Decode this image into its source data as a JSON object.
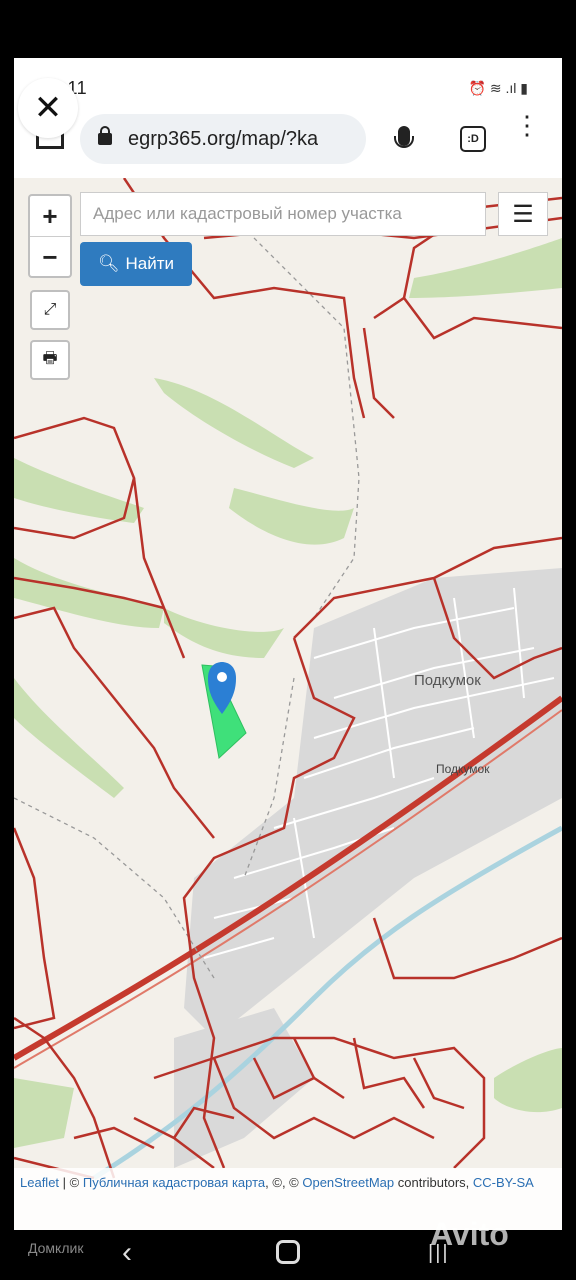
{
  "status": {
    "time": ":11",
    "icons_text": "⏰ ≋ .ıl ▮"
  },
  "browser": {
    "url": "egrp365.org/map/?ka",
    "tab_label": ":D",
    "close_glyph": "✕",
    "menu_glyph": "⋮"
  },
  "map": {
    "zoom_in": "+",
    "zoom_out": "−",
    "search_placeholder": "Адрес или кадастровый номер участка",
    "find_button": "Найти",
    "find_icon": "search-icon",
    "menu_glyph": "☰",
    "fullscreen_glyph": "⤢",
    "print_glyph": "🖶",
    "place_labels": [
      "Подкумок",
      "Подкумок"
    ],
    "attribution": {
      "leaflet": "Leaflet",
      "sep": " | © ",
      "cadastral": "Публичная кадастровая карта",
      "mid": ", ©, © ",
      "osm": "OpenStreetMap",
      "contrib": " contributors, ",
      "license": "CC-BY-SA"
    }
  },
  "nav": {
    "back": "‹",
    "recent": "|||"
  },
  "watermarks": {
    "left": "Домклик",
    "right": "Avito"
  }
}
